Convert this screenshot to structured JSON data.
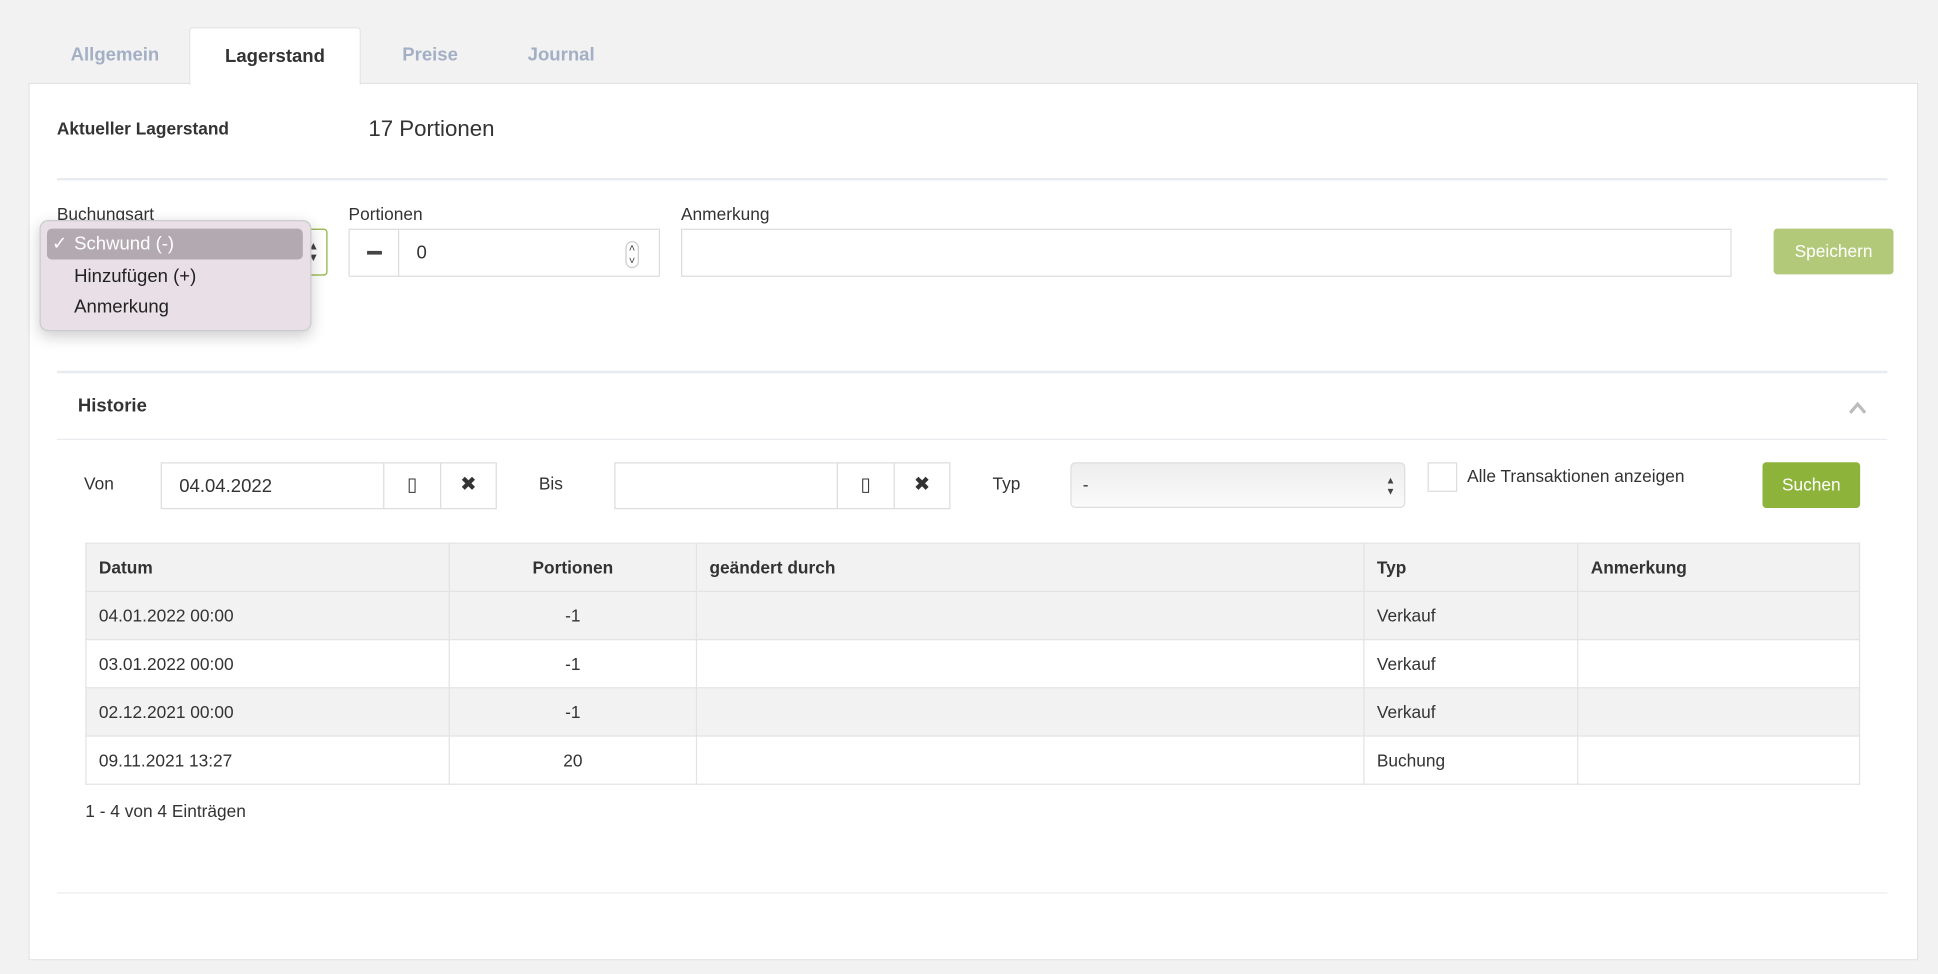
{
  "tabs": [
    {
      "label": "Allgemein"
    },
    {
      "label": "Lagerstand"
    },
    {
      "label": "Preise"
    },
    {
      "label": "Journal"
    }
  ],
  "active_tab": "Lagerstand",
  "stock": {
    "label": "Aktueller Lagerstand",
    "value": "17 Portionen"
  },
  "form": {
    "booking_type_label": "Buchungsart",
    "booking_type_options": [
      "Schwund (-)",
      "Hinzufügen (+)",
      "Anmerkung"
    ],
    "booking_type_selected": "Schwund (-)",
    "check_mark": "✓",
    "portions_label": "Portionen",
    "portions_value": "0",
    "note_label": "Anmerkung",
    "note_value": "",
    "save_label": "Speichern"
  },
  "history": {
    "title": "Historie",
    "from_label": "Von",
    "from_value": "04.04.2022",
    "to_label": "Bis",
    "to_value": "",
    "type_label": "Typ",
    "type_value": "-",
    "all_transactions_label": "Alle Transaktionen anzeigen",
    "all_transactions_checked": false,
    "search_label": "Suchen",
    "columns": [
      "Datum",
      "Portionen",
      "geändert durch",
      "Typ",
      "Anmerkung"
    ],
    "rows": [
      [
        "04.01.2022 00:00",
        "-1",
        "",
        "Verkauf",
        ""
      ],
      [
        "03.01.2022 00:00",
        "-1",
        "",
        "Verkauf",
        ""
      ],
      [
        "02.12.2021 00:00",
        "-1",
        "",
        "Verkauf",
        ""
      ],
      [
        "09.11.2021 13:27",
        "20",
        "",
        "Buchung",
        ""
      ]
    ],
    "footer": "1 - 4 von 4 Einträgen"
  },
  "colors": {
    "save_button": "#b3c97a",
    "search_button": "#8db33a",
    "select_border": "#8db33a"
  }
}
